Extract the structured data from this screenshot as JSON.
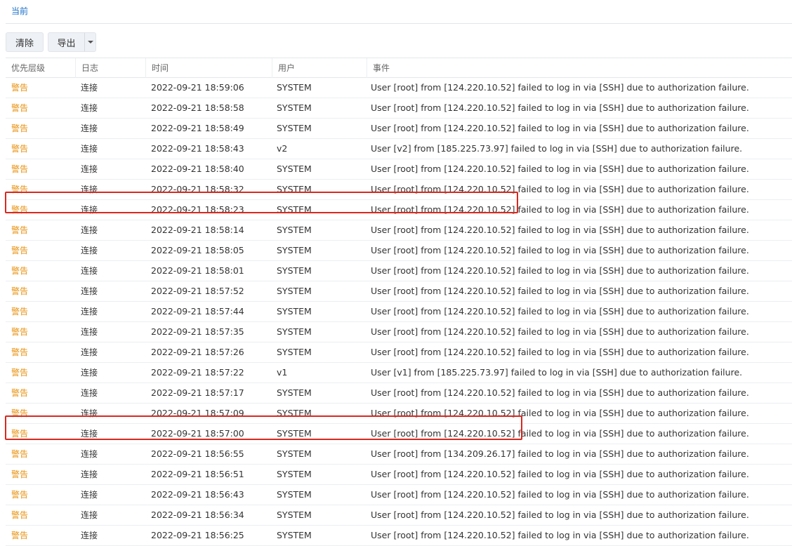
{
  "tabs": {
    "current": "当前"
  },
  "toolbar": {
    "clear_label": "清除",
    "export_label": "导出"
  },
  "columns": {
    "level": "优先层级",
    "log": "日志",
    "time": "时间",
    "user": "用户",
    "event": "事件"
  },
  "colors": {
    "warning": "#e8920f",
    "highlight": "#d9281f",
    "tab_active": "#1a6fc9"
  },
  "rows": [
    {
      "level": "警告",
      "log": "连接",
      "time": "2022-09-21 18:59:06",
      "user": "SYSTEM",
      "event": "User [root] from [124.220.10.52] failed to log in via [SSH] due to authorization failure."
    },
    {
      "level": "警告",
      "log": "连接",
      "time": "2022-09-21 18:58:58",
      "user": "SYSTEM",
      "event": "User [root] from [124.220.10.52] failed to log in via [SSH] due to authorization failure."
    },
    {
      "level": "警告",
      "log": "连接",
      "time": "2022-09-21 18:58:49",
      "user": "SYSTEM",
      "event": "User [root] from [124.220.10.52] failed to log in via [SSH] due to authorization failure."
    },
    {
      "level": "警告",
      "log": "连接",
      "time": "2022-09-21 18:58:43",
      "user": "v2",
      "event": "User [v2] from [185.225.73.97] failed to log in via [SSH] due to authorization failure."
    },
    {
      "level": "警告",
      "log": "连接",
      "time": "2022-09-21 18:58:40",
      "user": "SYSTEM",
      "event": "User [root] from [124.220.10.52] failed to log in via [SSH] due to authorization failure."
    },
    {
      "level": "警告",
      "log": "连接",
      "time": "2022-09-21 18:58:32",
      "user": "SYSTEM",
      "event": "User [root] from [124.220.10.52] failed to log in via [SSH] due to authorization failure."
    },
    {
      "level": "警告",
      "log": "连接",
      "time": "2022-09-21 18:58:23",
      "user": "SYSTEM",
      "event": "User [root] from [124.220.10.52] failed to log in via [SSH] due to authorization failure."
    },
    {
      "level": "警告",
      "log": "连接",
      "time": "2022-09-21 18:58:14",
      "user": "SYSTEM",
      "event": "User [root] from [124.220.10.52] failed to log in via [SSH] due to authorization failure."
    },
    {
      "level": "警告",
      "log": "连接",
      "time": "2022-09-21 18:58:05",
      "user": "SYSTEM",
      "event": "User [root] from [124.220.10.52] failed to log in via [SSH] due to authorization failure."
    },
    {
      "level": "警告",
      "log": "连接",
      "time": "2022-09-21 18:58:01",
      "user": "SYSTEM",
      "event": "User [root] from [124.220.10.52] failed to log in via [SSH] due to authorization failure."
    },
    {
      "level": "警告",
      "log": "连接",
      "time": "2022-09-21 18:57:52",
      "user": "SYSTEM",
      "event": "User [root] from [124.220.10.52] failed to log in via [SSH] due to authorization failure."
    },
    {
      "level": "警告",
      "log": "连接",
      "time": "2022-09-21 18:57:44",
      "user": "SYSTEM",
      "event": "User [root] from [124.220.10.52] failed to log in via [SSH] due to authorization failure."
    },
    {
      "level": "警告",
      "log": "连接",
      "time": "2022-09-21 18:57:35",
      "user": "SYSTEM",
      "event": "User [root] from [124.220.10.52] failed to log in via [SSH] due to authorization failure."
    },
    {
      "level": "警告",
      "log": "连接",
      "time": "2022-09-21 18:57:26",
      "user": "SYSTEM",
      "event": "User [root] from [124.220.10.52] failed to log in via [SSH] due to authorization failure."
    },
    {
      "level": "警告",
      "log": "连接",
      "time": "2022-09-21 18:57:22",
      "user": "v1",
      "event": "User [v1] from [185.225.73.97] failed to log in via [SSH] due to authorization failure."
    },
    {
      "level": "警告",
      "log": "连接",
      "time": "2022-09-21 18:57:17",
      "user": "SYSTEM",
      "event": "User [root] from [124.220.10.52] failed to log in via [SSH] due to authorization failure."
    },
    {
      "level": "警告",
      "log": "连接",
      "time": "2022-09-21 18:57:09",
      "user": "SYSTEM",
      "event": "User [root] from [124.220.10.52] failed to log in via [SSH] due to authorization failure."
    },
    {
      "level": "警告",
      "log": "连接",
      "time": "2022-09-21 18:57:00",
      "user": "SYSTEM",
      "event": "User [root] from [124.220.10.52] failed to log in via [SSH] due to authorization failure."
    },
    {
      "level": "警告",
      "log": "连接",
      "time": "2022-09-21 18:56:55",
      "user": "SYSTEM",
      "event": "User [root] from [134.209.26.17] failed to log in via [SSH] due to authorization failure."
    },
    {
      "level": "警告",
      "log": "连接",
      "time": "2022-09-21 18:56:51",
      "user": "SYSTEM",
      "event": "User [root] from [124.220.10.52] failed to log in via [SSH] due to authorization failure."
    },
    {
      "level": "警告",
      "log": "连接",
      "time": "2022-09-21 18:56:43",
      "user": "SYSTEM",
      "event": "User [root] from [124.220.10.52] failed to log in via [SSH] due to authorization failure."
    },
    {
      "level": "警告",
      "log": "连接",
      "time": "2022-09-21 18:56:34",
      "user": "SYSTEM",
      "event": "User [root] from [124.220.10.52] failed to log in via [SSH] due to authorization failure."
    },
    {
      "level": "警告",
      "log": "连接",
      "time": "2022-09-21 18:56:25",
      "user": "SYSTEM",
      "event": "User [root] from [124.220.10.52] failed to log in via [SSH] due to authorization failure."
    }
  ]
}
